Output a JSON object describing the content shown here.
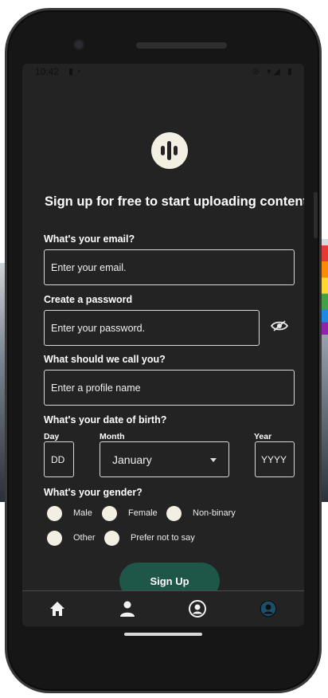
{
  "status_bar": {
    "time": "10:42",
    "left_icons": "▮ ◔",
    "right_icons": "⊘ ▾◢ ▮"
  },
  "form": {
    "headline": "Sign up for free to start uploading content.",
    "email_label": "What's your email?",
    "email_placeholder": "Enter your email.",
    "password_label": "Create a password",
    "password_placeholder": "Enter your password.",
    "profile_label": "What should we call you?",
    "profile_placeholder": "Enter a profile name",
    "dob_label": "What's your date of birth?",
    "day_label": "Day",
    "day_placeholder": "DD",
    "month_label": "Month",
    "month_value": "January",
    "year_label": "Year",
    "year_placeholder": "YYYY",
    "gender_label": "What's your gender?",
    "gender_options": [
      "Male",
      "Female",
      "Non-binary",
      "Other",
      "Prefer not to say"
    ],
    "submit_label": "Sign Up"
  },
  "colors": {
    "screen_bg": "#232323",
    "accent_button": "#1e5647",
    "radio_fill": "#f3efe2",
    "nav_active": "#1c4f6e"
  },
  "nav": {
    "items": [
      "home-icon",
      "user-icon",
      "profile-circle-icon",
      "account-active-icon"
    ]
  }
}
